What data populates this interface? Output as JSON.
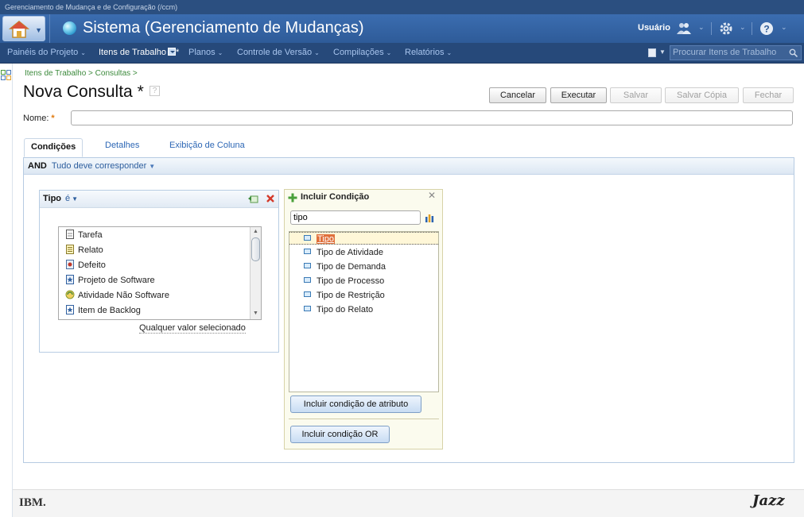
{
  "window": {
    "title": "Gerenciamento de Mudança e de Configuração (/ccm)"
  },
  "header": {
    "app_title": "Sistema (Gerenciamento de Mudanças)",
    "user_label": "Usuário",
    "icons": [
      "home-icon",
      "globe-icon",
      "users-icon",
      "gear-icon",
      "help-icon"
    ]
  },
  "nav": {
    "items": [
      {
        "label": "Painéis do Projeto",
        "caret": "⌄"
      },
      {
        "label": "Itens de Trabalho",
        "suffix": "*"
      },
      {
        "label": "Planos",
        "caret": "⌄"
      },
      {
        "label": "Controle de Versão",
        "caret": "⌄"
      },
      {
        "label": "Compilações",
        "caret": "⌄"
      },
      {
        "label": "Relatórios",
        "caret": "⌄"
      }
    ],
    "search_placeholder": "Procurar Itens de Trabalho"
  },
  "page": {
    "breadcrumb": "Itens de Trabalho > Consultas >",
    "title": "Nova Consulta *",
    "help": "?",
    "buttons": {
      "cancel": "Cancelar",
      "execute": "Executar",
      "save": "Salvar",
      "save_copy": "Salvar Cópia",
      "close": "Fechar"
    },
    "name_label": "Nome:",
    "name_required": "*",
    "name_value": ""
  },
  "tabs": [
    "Condições",
    "Detalhes",
    "Exibição de Coluna"
  ],
  "conditions": {
    "operator": "AND",
    "mode": "Tudo deve corresponder",
    "card": {
      "attribute": "Tipo",
      "op": "é",
      "values": [
        {
          "label": "Tarefa",
          "icon": "task-icon"
        },
        {
          "label": "Relato",
          "icon": "story-icon"
        },
        {
          "label": "Defeito",
          "icon": "defect-icon"
        },
        {
          "label": "Projeto de Software",
          "icon": "software-project-icon"
        },
        {
          "label": "Atividade Não Software",
          "icon": "non-software-activity-icon"
        },
        {
          "label": "Item de Backlog",
          "icon": "backlog-item-icon"
        }
      ],
      "any_value": "Qualquer valor selecionado"
    }
  },
  "include_panel": {
    "title": "Incluir Condição",
    "search_value": "tipo",
    "attributes": [
      "Tipo",
      "Tipo de Atividade",
      "Tipo de Demanda",
      "Tipo de Processo",
      "Tipo de Restrição",
      "Tipo do Relato"
    ],
    "selected": "Tipo",
    "add_attribute_button": "Incluir condição de atributo",
    "add_or_button": "Incluir condição OR"
  },
  "footer": {
    "left_logo": "IBM.",
    "right_logo": "Jazz"
  },
  "colors": {
    "banner": "#2b4f80",
    "nav": "#26497a",
    "accent": "#2d67b5",
    "selection": "#e0703c"
  }
}
